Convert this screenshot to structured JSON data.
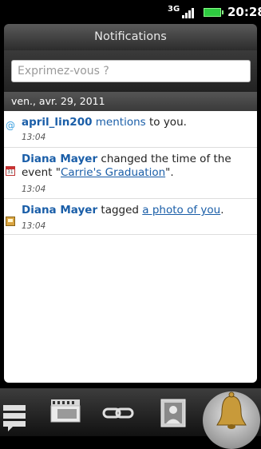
{
  "status_bar": {
    "network": "3G",
    "time": "20:28"
  },
  "header": {
    "title": "Notifications"
  },
  "composer": {
    "placeholder": "Exprimez-vous ?"
  },
  "date_header": "ven., avr. 29, 2011",
  "notifications": [
    {
      "user": "april_lin200",
      "action": "mentions",
      "rest": " to you.",
      "time": "13:04",
      "icon": "mention-icon"
    },
    {
      "user": "Diana Mayer",
      "text1": " changed the time of the event \"",
      "link": "Carrie's Graduation",
      "text2": "\".",
      "time": "13:04",
      "icon": "calendar-icon"
    },
    {
      "user": "Diana Mayer",
      "text1": " tagged ",
      "link": "a photo of you",
      "text2": ".",
      "time": "13:04",
      "icon": "photo-icon"
    }
  ],
  "tabs": [
    {
      "name": "updates",
      "icon": "updates-icon"
    },
    {
      "name": "photos",
      "icon": "film-icon"
    },
    {
      "name": "links",
      "icon": "link-icon"
    },
    {
      "name": "contacts",
      "icon": "contact-icon"
    },
    {
      "name": "notifications",
      "icon": "bell-icon",
      "selected": true
    }
  ]
}
